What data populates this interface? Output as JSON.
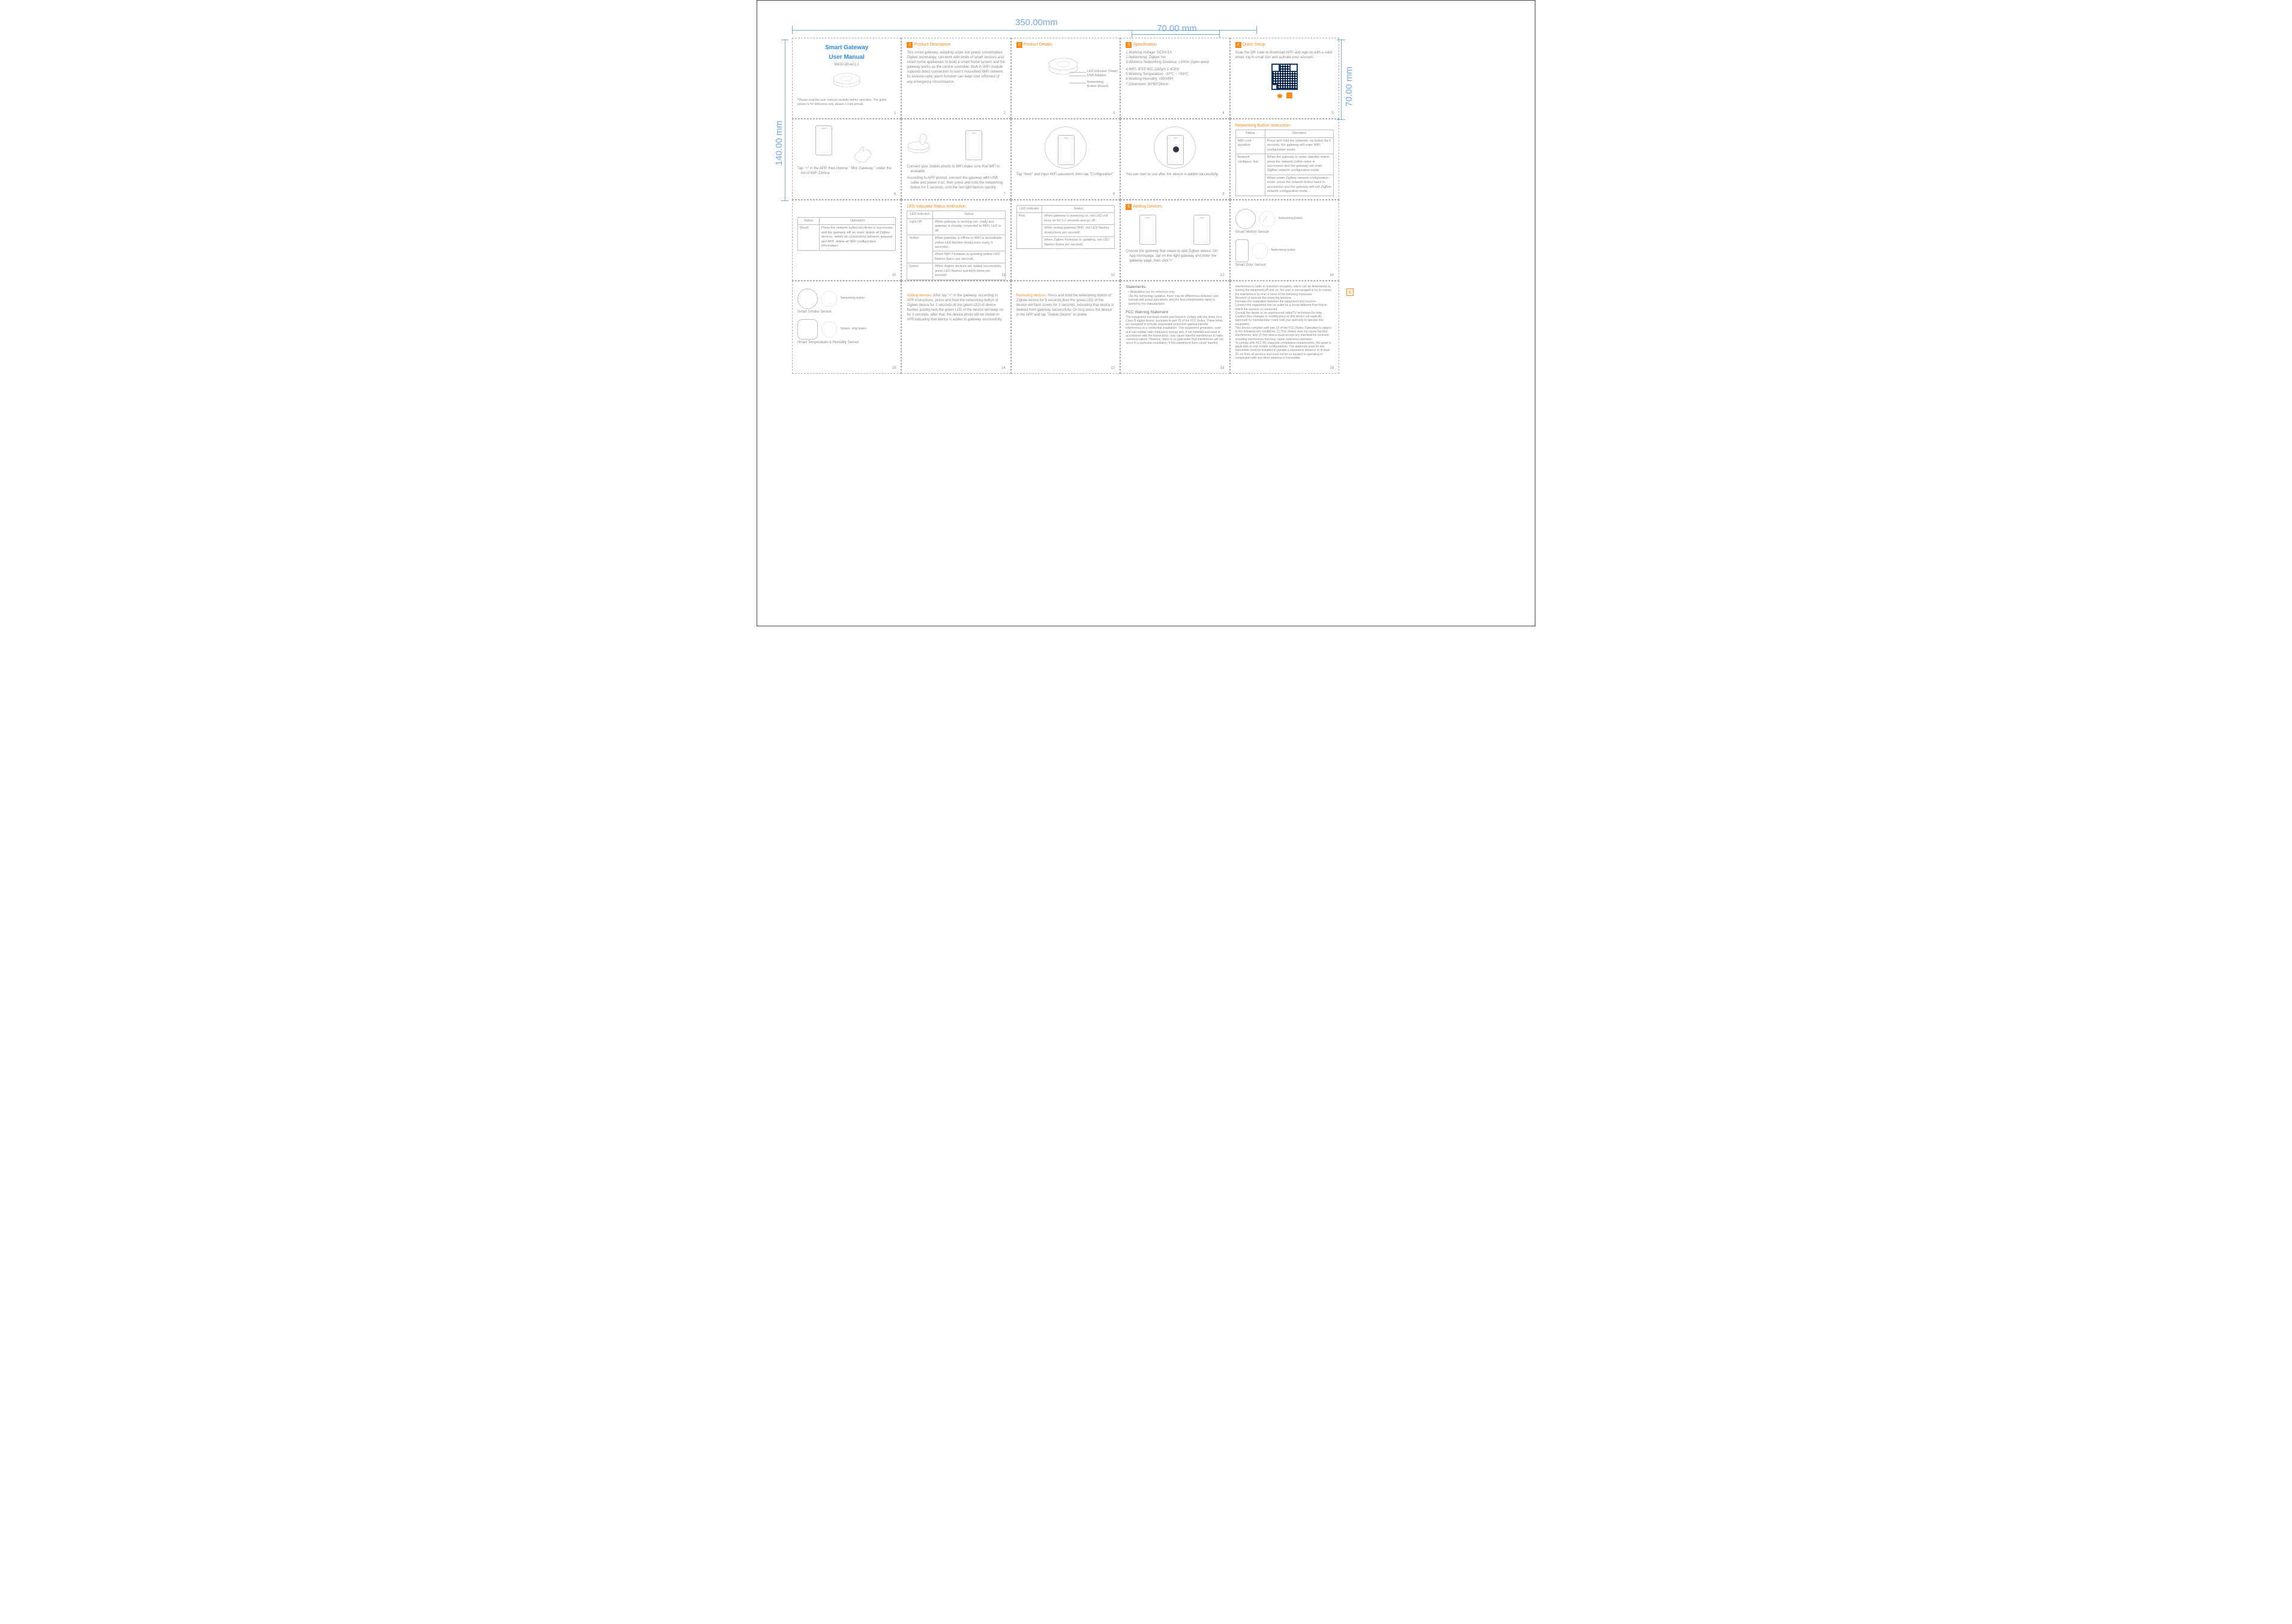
{
  "dims": {
    "w350": "350.00mm",
    "w70": "70.00 mm",
    "h70": "70.00 mm",
    "h140": "140.00 mm"
  },
  "p1": {
    "title1": "Smart Gateway",
    "title2": "User Manual",
    "model": "M420-3Ever1.1",
    "note": "*Please read the user manual carefully before operation. The guide picture is for reference only, please in kind prevail."
  },
  "p2": {
    "hd": "Product Description",
    "body": "This smart gateway, adopting super low power consumption Zigbee technology, can work with kinds of smart sensors and smart home appliances to build a smart home system and the gateway works as the central controller. Built-in WiFi module supports direct connection to user's household WiFi network. Its acousto-optic alarm function can keep user informed of any emergency circumstance."
  },
  "p3": {
    "hd": "Product Details",
    "l1": "LED indicator (State)",
    "l2": "USB Adaptor",
    "l3": "Networking Button (Reset)"
  },
  "p4": {
    "hd": "Specification",
    "s1": "1.Working Voltage: DC5V/1A",
    "s2": "2.Networking: Zigbee HA",
    "s3": "3.Wireless Networking Distance: ≤100m (open area)",
    "s4": "4.WiFi: IEEE 802.11b/g/n 2.4GHz",
    "s5": "5.Working Temperature: -10℃ ~ +50℃",
    "s6": "6.Working Humidity: ≤95%RH",
    "s7": "7.Dimension: 80*80*28mm"
  },
  "p5": {
    "hd": "Quick Setup",
    "body": "Scan the QR code to download APP, and sign up with a valid email, log in email box and activate your account."
  },
  "p6bullet": "Tap \"+\" in the APP, then choose \" Mini Gateway \" under the list of WiFi Device.",
  "p7b1": "Connect your mobile phone to WiFi,make sure that WiFi is available.",
  "p7b2": "According to APP prompt, connect the gateway with USB cable and power it on, then press and hold the networking button for 5 seconds, until the red light flashes quickly.",
  "p8b": "Tap \"Next\" and input WiFi password, then tap \"Configuration\"",
  "p9b": "You can start to use after the device is added successfully.",
  "netHd": "Networking Button Instruction",
  "netCols": {
    "a": "Status",
    "b": "Operation"
  },
  "netRows": [
    {
      "a": "WiFi conf- iguration",
      "b": "Press and hold the networki- ng button for 5 seconds, the gateway will enter WiFi configuration mode."
    },
    {
      "a": "Network configura- tion",
      "b": "When the gateway is under standby status, press the network button twice in succession and the gateway will enter ZigBee network configuration mode."
    },
    {
      "a": "",
      "b": "When under ZigBee network configuration mode, press the network button twice in succession and the gateway will exit ZigBee network configuration mode."
    }
  ],
  "resetCols": {
    "a": "Status",
    "b": "Operation"
  },
  "resetRow": {
    "a": "Reset",
    "b": "Press the network button ten times in succession and the gateway will be reset: delete all Zigbee devices, delete all connections between gateway and APP, delete all WiFi configuration information."
  },
  "ledHd": "LED Indicator Status Instruction",
  "ledCols": {
    "a": "LED indicator",
    "b": "Status"
  },
  "ledRows": [
    {
      "a": "Light Off",
      "b": "When gateway is working nor- mally and gateway is already connected to WiFi, LED is off."
    },
    {
      "a": "Yellow",
      "b": "When gateway is offline or WiFi is unavailable, yellow LED flashes slowly(once every 3 seconds)."
    },
    {
      "a": "",
      "b": "When WiFi Firmware is updating,yellow LED flashes (twice per second)."
    },
    {
      "a": "Green",
      "b": "When Zigbee devices are added successfully, green LED flashes quickly(5 times per second)."
    }
  ],
  "ledRows2": [
    {
      "a": "Red",
      "b": "When gateway is powering on, red LED will keep on for 0.2 seconds and go off."
    },
    {
      "a": "",
      "b": "While setting gateway WiFi, red LED flashes slowly(once per second)."
    },
    {
      "a": "",
      "b": "When Zigbee Firmware is updating, red LED flashes (twice per second)."
    }
  ],
  "p13hd": "Adding Devices",
  "p13b": "Choose the gateway that needs to add Zigbee device. On App homepage, tap on the right gateway and enter the gateway page, then click\"+\".",
  "p14a": "Smart Motion Sensor",
  "p14b": "Smart Door Sensor",
  "p14n": "Networking button",
  "p15a": "Smart Smoke Sensor",
  "p15b": "Smart Temperature & Humidity Sensor",
  "p15n": "Networ- king button",
  "p16hd": "Adding devices:",
  "p16body": " After tap \"+\" in the gateway, according to APP instructions, press and hold the networking button of Zigbee device for 2 seconds,till the green LED of device flashes quickly,next,the green LED of the device will keep on for 3 seconds, after that, the device photo will be shown in APP,indicating that device is added to gateway successfully.",
  "p17hd": "Removing devices:",
  "p17body": "  Press and hold the networking button of Zigbee device for 5 seconds,then the green LED of the device will flash slowly for 3 seconds, indicating that device is deleted from gateway successfully. Or long press the device in the APP and tap \"Delete Device\" to delete.",
  "p18hd": "Statements:",
  "p18s1": "• Illustrations are for reference only.",
  "p18s2": "• As the technology updates, there may be differences between user manual and actual operations, and the final interpretation rights is owned by the manufacturer.",
  "p18fcc": "FCC Warning Statement",
  "p18fccbody": "This equipment has been tested and found to comply with the limits for a Class B digital device, pursuant to part 15 of the FCC Rules. These limits are designed to provide reasonable protection against harmful interference in a residential installation. This equipment generates, uses and can radiate radio frequency energy and, if not installed and used in accordance with the instructions, may cause harmful interference to radio communications. However, there is no guarantee that interference will not occur in a particular installation. If this equipment does cause harmful",
  "p19body": "interference to radio or television reception, which can be determined by turning the equipment off and on, the user is encouraged to try to correct the interference by one or more of the following measures:\nReorient or relocate the receiving antenna.\nIncrease the separation between the equipment and receiver.\nConnect the equipment into an outlet on a circuit different from that to which the receiver is connected.\nConsult the dealer or an experienced radio/TV technician for help.\nCaution: Any changes or modifications to this device not explicitly approved by manufacturer could void your authority to operate this equipment.\nThis device complies with part 15 of the FCC Rules. Operation is subject to the following two conditions: (1) This device may not cause harmful interference, and (2) this device must accept any interference received, including interference that may cause undesired operation.\nTo comply with FCC RF exposure compliance requirements, this grant is applicable to only mobile configurations. The antennas used for this transmitter must be installed to provide a separation distance of at least 20 cm from all persons and must not be co-located or operating in conjunction with any other antenna or transmitter."
}
